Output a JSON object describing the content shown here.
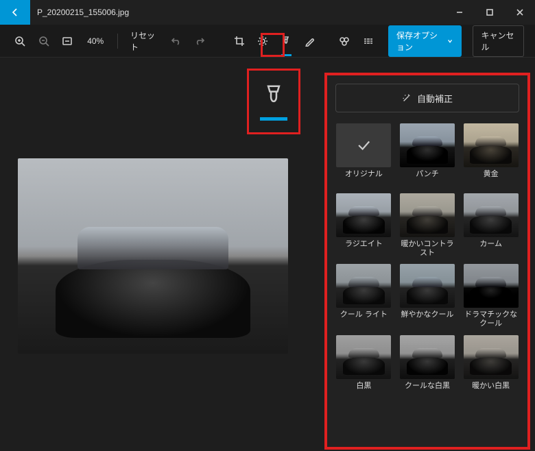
{
  "titlebar": {
    "filename": "P_20200215_155006.jpg"
  },
  "toolbar": {
    "zoom_pct": "40%",
    "reset_label": "リセット",
    "save_label": "保存オプション",
    "cancel_label": "キャンセル"
  },
  "panel": {
    "auto_correct_label": "自動補正",
    "filters": [
      {
        "label": "オリジナル"
      },
      {
        "label": "パンチ"
      },
      {
        "label": "黄金"
      },
      {
        "label": "ラジエイト"
      },
      {
        "label": "暖かいコントラスト"
      },
      {
        "label": "カーム"
      },
      {
        "label": "クール ライト"
      },
      {
        "label": "鮮やかなクール"
      },
      {
        "label": "ドラマチックなクール"
      },
      {
        "label": "白黒"
      },
      {
        "label": "クールな白黒"
      },
      {
        "label": "暖かい白黒"
      }
    ]
  },
  "colors": {
    "accent": "#0096d6",
    "highlight": "#e02020"
  }
}
